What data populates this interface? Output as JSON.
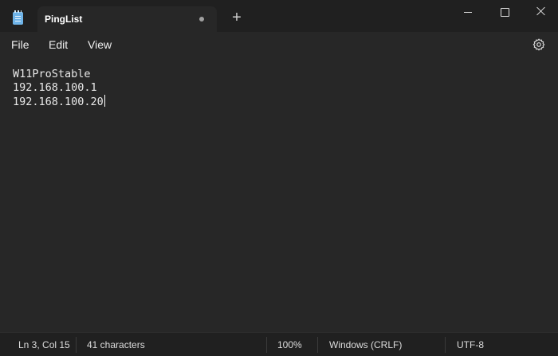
{
  "tab": {
    "title": "PingList"
  },
  "new_tab_symbol": "+",
  "menu": {
    "file": "File",
    "edit": "Edit",
    "view": "View"
  },
  "editor": {
    "lines": [
      "W11ProStable",
      "192.168.100.1",
      "192.168.100.20"
    ]
  },
  "status": {
    "position": "Ln 3, Col 15",
    "characters": "41 characters",
    "zoom": "100%",
    "line_ending": "Windows (CRLF)",
    "encoding": "UTF-8"
  },
  "icons": {
    "app": "notepad-icon",
    "unsaved": "unsaved-dot-icon",
    "settings": "gear-icon",
    "minimize": "minimize-icon",
    "maximize": "maximize-icon",
    "close": "close-icon"
  },
  "colors": {
    "background": "#272727",
    "titlebar": "#202020",
    "text": "#e8e8e8"
  }
}
